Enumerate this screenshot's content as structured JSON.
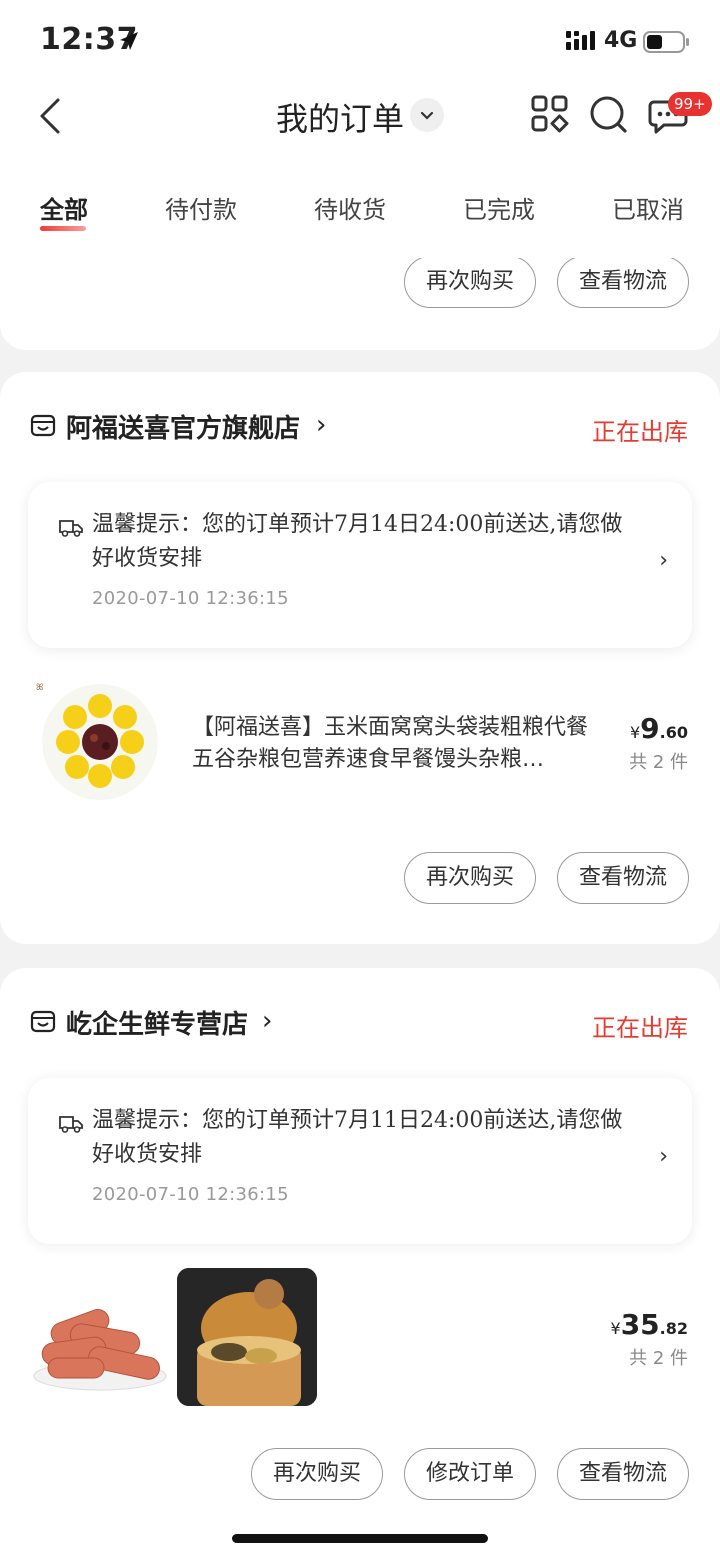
{
  "status_bar": {
    "time": "12:37",
    "network": "4G"
  },
  "header": {
    "title": "我的订单",
    "message_badge": "99+"
  },
  "tabs": [
    {
      "label": "全部"
    },
    {
      "label": "待付款"
    },
    {
      "label": "待收货"
    },
    {
      "label": "已完成"
    },
    {
      "label": "已取消"
    }
  ],
  "prev_card": {
    "buttons": [
      "再次购买",
      "查看物流"
    ]
  },
  "orders": [
    {
      "store": "阿福送喜官方旗舰店",
      "status": "正在出库",
      "tip_label": "温馨提示：",
      "tip": "您的订单预计7月14日24:00前送达,请您做好收货安排",
      "tip_time": "2020-07-10 12:36:15",
      "product_title": "【阿福送喜】玉米面窝窝头袋装粗粮代餐五谷杂粮包营养速食早餐馒头杂粮…",
      "price_currency": "¥",
      "price_int": "9",
      "price_dec": ".60",
      "quantity": "共 2 件",
      "buttons": [
        "再次购买",
        "查看物流"
      ]
    },
    {
      "store": "屹企生鲜专营店",
      "status": "正在出库",
      "tip_label": "温馨提示：",
      "tip": "您的订单预计7月11日24:00前送达,请您做好收货安排",
      "tip_time": "2020-07-10 12:36:15",
      "price_currency": "¥",
      "price_int": "35",
      "price_dec": ".82",
      "quantity": "共 2 件",
      "buttons": [
        "再次购买",
        "修改订单",
        "查看物流"
      ]
    }
  ],
  "colors": {
    "accent": "#e63c30",
    "badge": "#e8322f",
    "background": "#f2f2f2"
  },
  "icons": [
    "location-arrow-icon",
    "signal-icon",
    "battery-icon",
    "back-icon",
    "chevron-down-icon",
    "apps-icon",
    "search-icon",
    "message-icon",
    "store-icon",
    "truck-icon",
    "chevron-right-icon"
  ]
}
